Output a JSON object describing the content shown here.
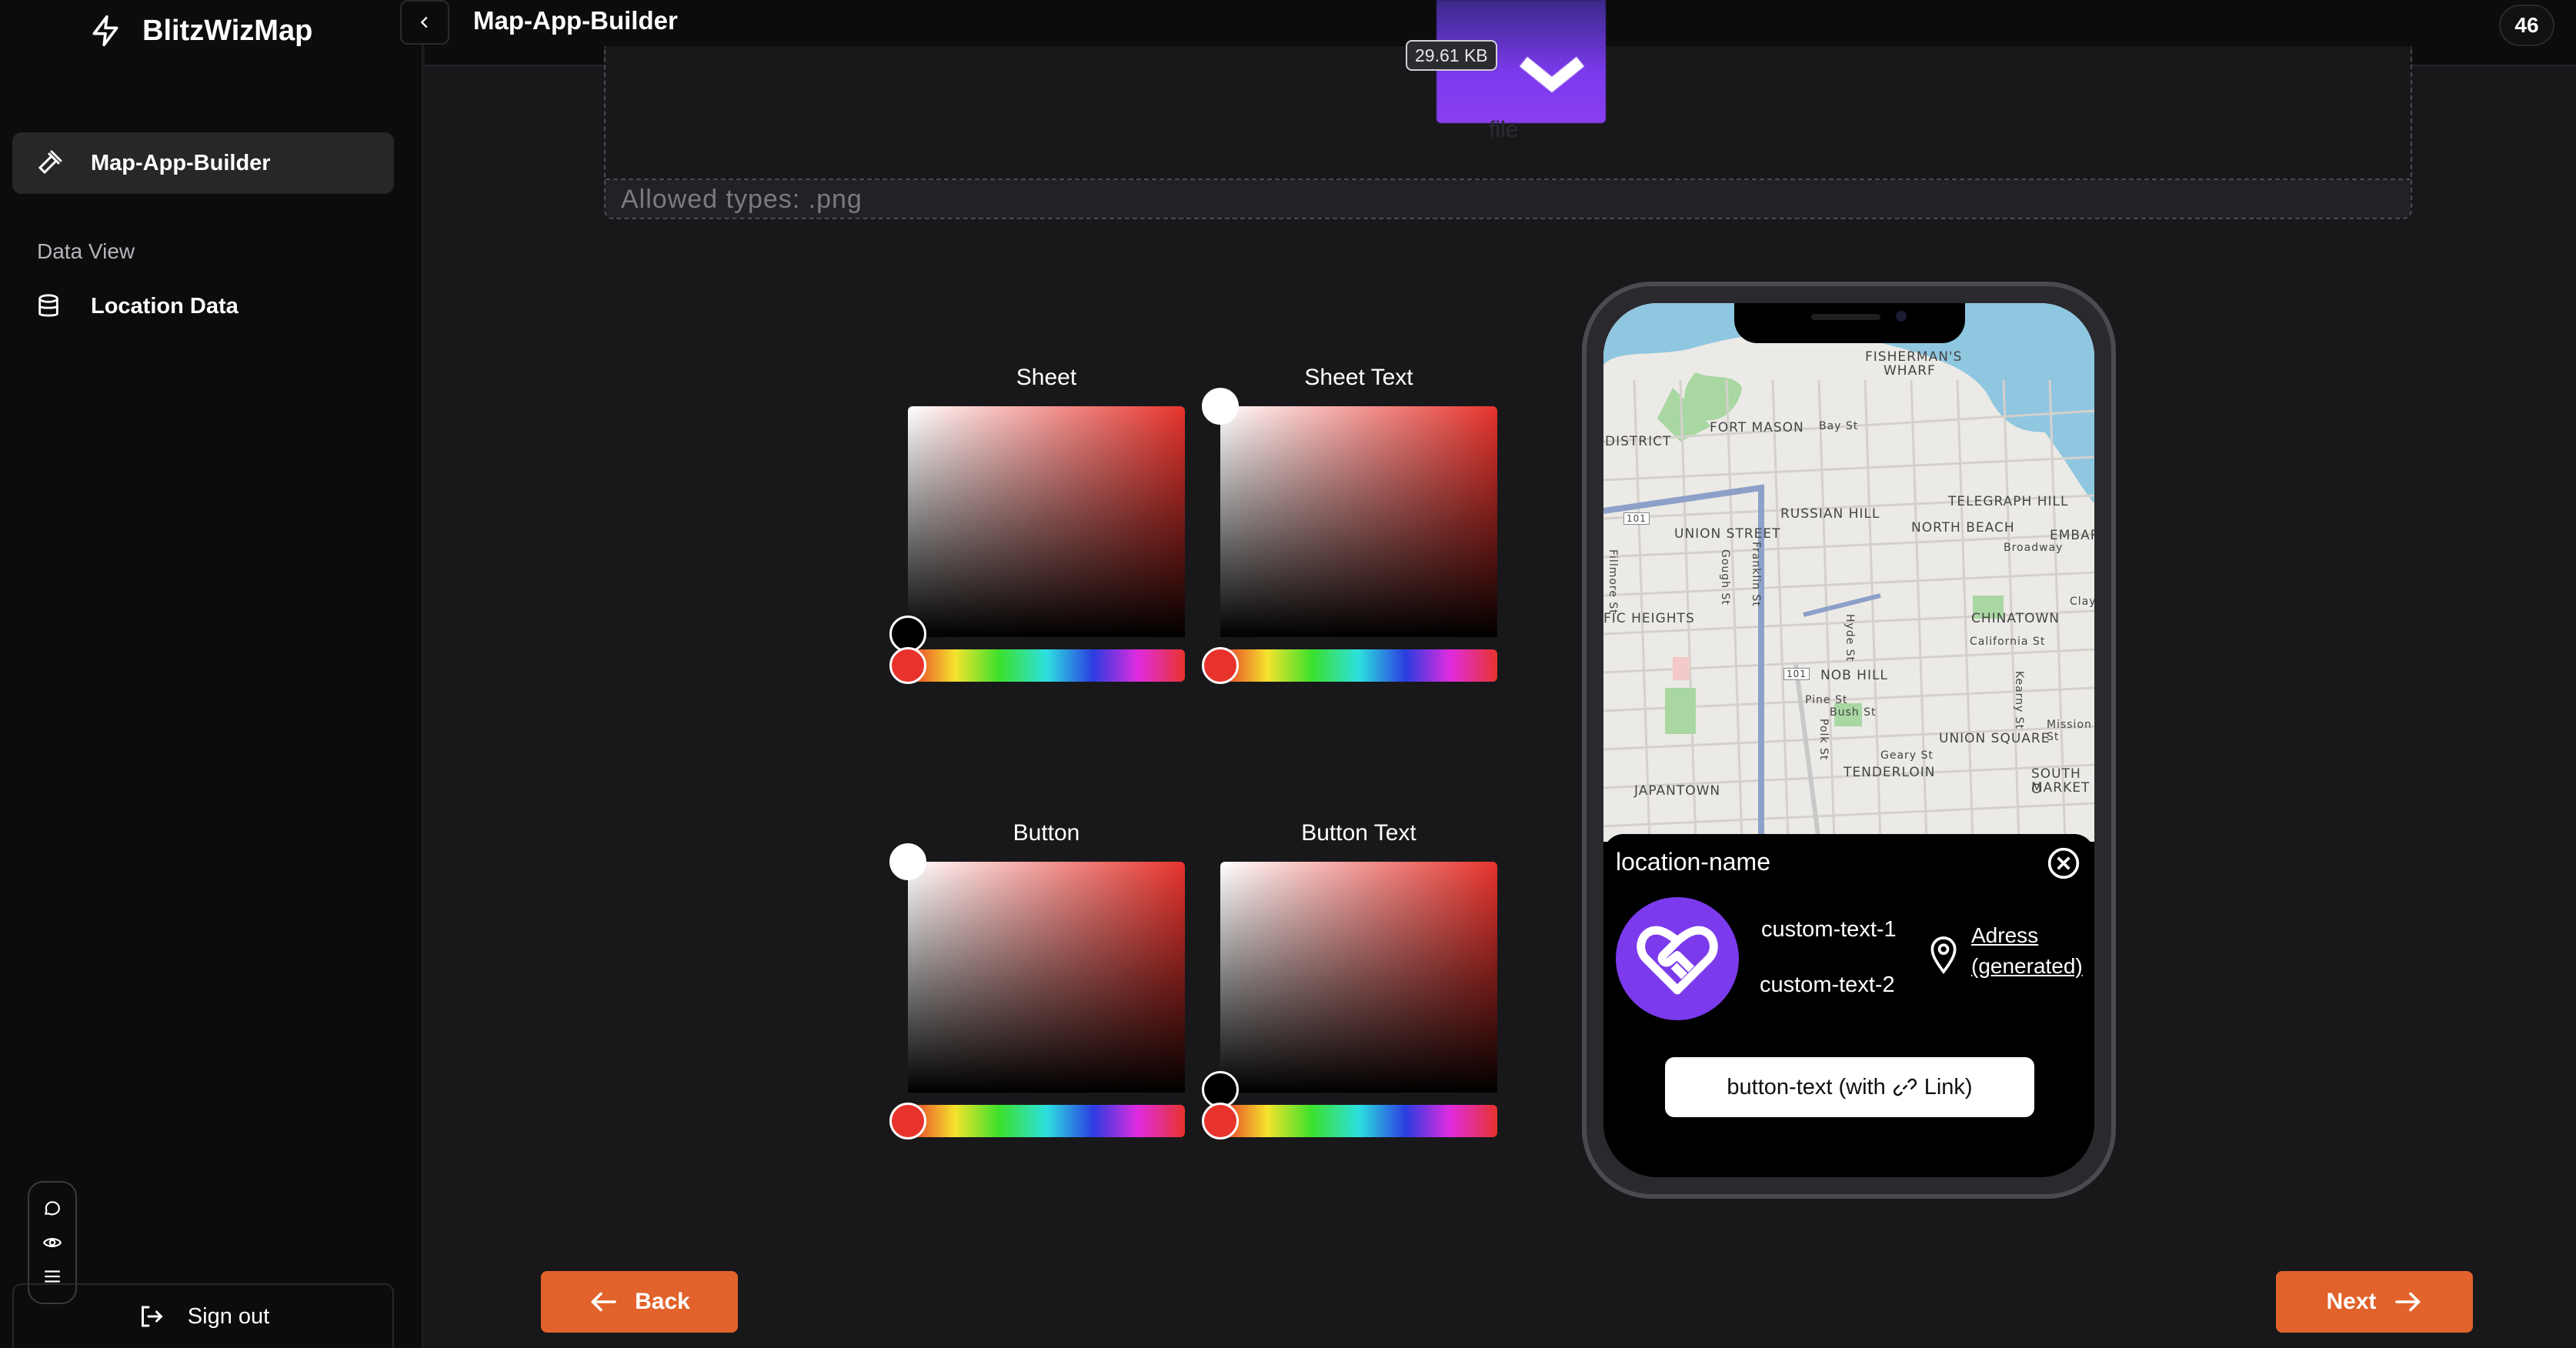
{
  "brand": {
    "name": "BlitzWizMap"
  },
  "sidebar": {
    "active_item": "Map-App-Builder",
    "section_label": "Data View",
    "location_item": "Location Data",
    "signout": "Sign out"
  },
  "header": {
    "title": "Map-App-Builder",
    "counter": "46"
  },
  "upload": {
    "file_size": "29.61 KB",
    "file_label": "file",
    "allowed_types": "Allowed types: .png"
  },
  "pickers": {
    "sheet": "Sheet",
    "sheet_text": "Sheet Text",
    "button": "Button",
    "button_text": "Button Text"
  },
  "preview": {
    "map_labels": [
      "FISHERMAN'S",
      "WHARF",
      "FORT MASON",
      "DISTRICT",
      "Bay St",
      "RUSSIAN HILL",
      "TELEGRAPH HILL",
      "NORTH BEACH",
      "UNION STREET",
      "EMBAR",
      "Broadway",
      "Fillmore St",
      "Gough St",
      "Franklin St",
      "FIC HEIGHTS",
      "CHINATOWN",
      "California St",
      "Hyde St",
      "NOB HILL",
      "Pine St",
      "Bush St",
      "Kearny St",
      "UNION SQUARE",
      "Geary St",
      "TENDERLOIN",
      "SOUTH O",
      "MARKET",
      "JAPANTOWN",
      "Polk St",
      "Mission St",
      "Clay",
      "101",
      "101"
    ],
    "location_name": "location-name",
    "custom_text_1": "custom-text-1",
    "custom_text_2": "custom-text-2",
    "address_line1": "Adress",
    "address_line2": "(generated)",
    "button_text_a": "button-text (with",
    "button_text_b": "Link)"
  },
  "actions": {
    "back": "Back",
    "next": "Next"
  },
  "colors": {
    "accent": "#e1622a",
    "brand_purple": "#7c3aed",
    "picker_red": "#e7332c"
  }
}
